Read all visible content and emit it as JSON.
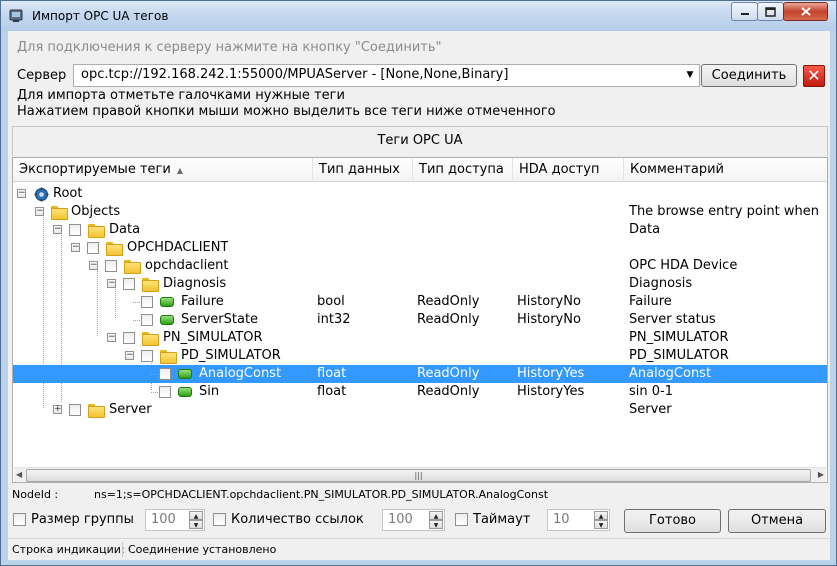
{
  "window": {
    "title": "Импорт OPC UA тегов"
  },
  "hint_connect": "Для подключения к серверу нажмите на кнопку \"Соединить\"",
  "server": {
    "label": "Сервер",
    "value": "opc.tcp://192.168.242.1:55000/MPUAServer - [None,None,Binary]",
    "connect_label": "Соединить"
  },
  "hint_import": "Для импорта отметьте галочками нужные теги",
  "hint_rightclick": "Нажатием правой кнопки мыши можно выделить все теги ниже отмеченного",
  "panel_title": "Теги OPC UA",
  "columns": {
    "tags": "Экспортируемые теги",
    "type": "Тип данных",
    "access": "Тип доступа",
    "hda": "HDA доступ",
    "comment": "Комментарий"
  },
  "tree": [
    {
      "name": "Root",
      "type": "",
      "access": "",
      "hda": "",
      "comment": "",
      "icon": "root-icon"
    },
    {
      "name": "Objects",
      "type": "",
      "access": "",
      "hda": "",
      "comment": "The browse entry point when",
      "icon": "folder-icon"
    },
    {
      "name": "Data",
      "type": "",
      "access": "",
      "hda": "",
      "comment": "Data",
      "icon": "folder-icon"
    },
    {
      "name": "OPCHDACLIENT",
      "type": "",
      "access": "",
      "hda": "",
      "comment": "",
      "icon": "folder-icon"
    },
    {
      "name": "opchdaclient",
      "type": "",
      "access": "",
      "hda": "",
      "comment": "OPC HDA Device",
      "icon": "folder-icon"
    },
    {
      "name": "Diagnosis",
      "type": "",
      "access": "",
      "hda": "",
      "comment": "Diagnosis",
      "icon": "folder-icon"
    },
    {
      "name": "Failure",
      "type": "bool",
      "access": "ReadOnly",
      "hda": "HistoryNo",
      "comment": "Failure",
      "icon": "tag-icon"
    },
    {
      "name": "ServerState",
      "type": "int32",
      "access": "ReadOnly",
      "hda": "HistoryNo",
      "comment": "Server status",
      "icon": "tag-icon"
    },
    {
      "name": "PN_SIMULATOR",
      "type": "",
      "access": "",
      "hda": "",
      "comment": "PN_SIMULATOR",
      "icon": "folder-icon"
    },
    {
      "name": "PD_SIMULATOR",
      "type": "",
      "access": "",
      "hda": "",
      "comment": "PD_SIMULATOR",
      "icon": "folder-icon"
    },
    {
      "name": "AnalogConst",
      "type": "float",
      "access": "ReadOnly",
      "hda": "HistoryYes",
      "comment": "AnalogConst",
      "icon": "tag-icon"
    },
    {
      "name": "Sin",
      "type": "float",
      "access": "ReadOnly",
      "hda": "HistoryYes",
      "comment": "sin 0-1",
      "icon": "tag-icon"
    },
    {
      "name": "Server",
      "type": "",
      "access": "",
      "hda": "",
      "comment": "Server",
      "icon": "folder-icon"
    }
  ],
  "nodeid": {
    "label": "NodeId :",
    "value": "ns=1;s=OPCHDACLIENT.opchdaclient.PN_SIMULATOR.PD_SIMULATOR.AnalogConst"
  },
  "options": {
    "group_size_label": "Размер группы",
    "group_size_value": "100",
    "refs_count_label": "Количество ссылок",
    "refs_count_value": "100",
    "timeout_label": "Таймаут",
    "timeout_value": "10"
  },
  "buttons": {
    "ok": "Готово",
    "cancel": "Отмена"
  },
  "status": {
    "label": "Строка индикации:",
    "value": "Соединение установлено"
  },
  "colors": {
    "selection": "#3399ff",
    "titlebar": "#c3d7ef",
    "close": "#c4432c"
  }
}
